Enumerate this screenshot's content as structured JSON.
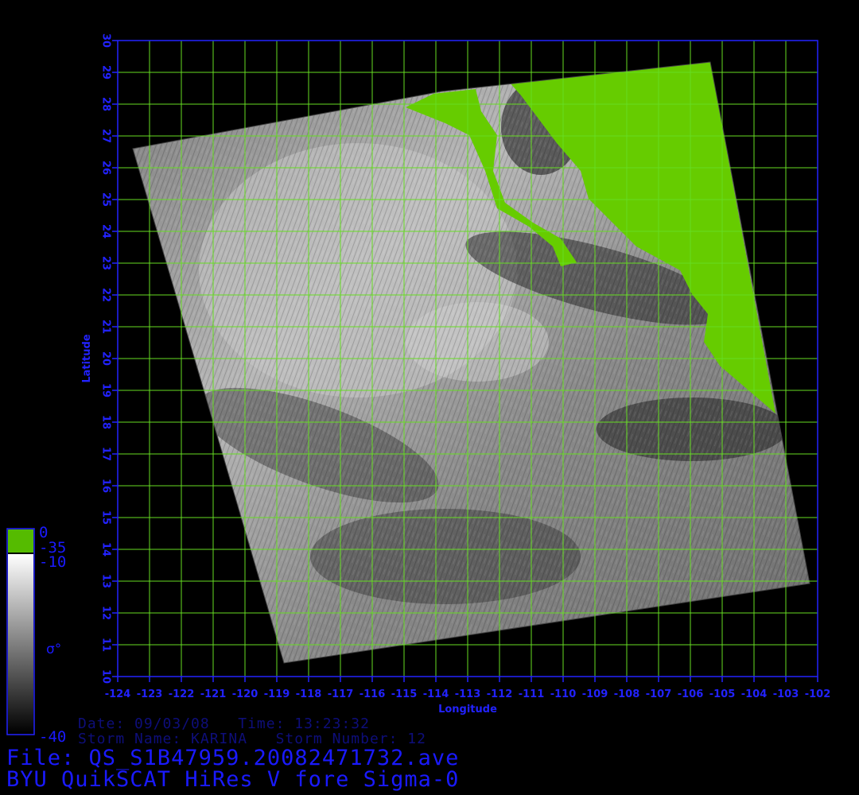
{
  "map": {
    "lon_min": -124,
    "lon_max": -102,
    "lat_min": 10,
    "lat_max": 30,
    "x_axis_label": "Longitude",
    "y_axis_label": "Latitude",
    "x_ticks": [
      "-124",
      "-123",
      "-122",
      "-121",
      "-120",
      "-119",
      "-118",
      "-117",
      "-116",
      "-115",
      "-114",
      "-113",
      "-112",
      "-111",
      "-110",
      "-109",
      "-108",
      "-107",
      "-106",
      "-105",
      "-104",
      "-103",
      "-102"
    ],
    "y_ticks": [
      "10",
      "11",
      "12",
      "13",
      "14",
      "15",
      "16",
      "17",
      "18",
      "19",
      "20",
      "21",
      "22",
      "23",
      "24",
      "25",
      "26",
      "27",
      "28",
      "29",
      "30"
    ],
    "grid": true,
    "grid_color": "#66dd22",
    "axis_color": "#2222ff",
    "land_color": "#66cc00",
    "swath_colors": [
      "#2a2a2a",
      "#8a8a8a",
      "#bdbdbd"
    ]
  },
  "colorbar": {
    "labels": [
      "0",
      "-35",
      "-10",
      "-40"
    ],
    "symbol": "σ°",
    "land_color": "#55bb00"
  },
  "info": {
    "date_line": "Date: 09/03/08   Time: 13:23:32",
    "storm_line": "Storm Name: KARINA   Storm Number: 12",
    "file_line": "File: QS_S1B47959.20082471732.ave",
    "title_line": "BYU QuikSCAT HiRes V fore Sigma-0"
  }
}
